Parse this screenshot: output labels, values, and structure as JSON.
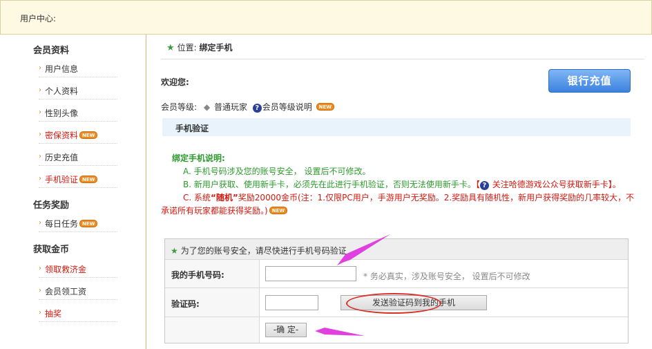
{
  "header": {
    "title": "用户中心:"
  },
  "sidebar": {
    "groups": [
      {
        "title": "会员资料",
        "items": [
          {
            "label": "用户信息",
            "color": "normal",
            "new": false
          },
          {
            "label": "个人资料",
            "color": "normal",
            "new": false
          },
          {
            "label": "性别头像",
            "color": "normal",
            "new": false
          },
          {
            "label": "密保资料",
            "color": "red",
            "new": true
          },
          {
            "label": "历史充值",
            "color": "normal",
            "new": false
          },
          {
            "label": "手机验证",
            "color": "red",
            "new": true
          }
        ]
      },
      {
        "title": "任务奖励",
        "items": [
          {
            "label": "每日任务",
            "color": "normal",
            "new": true
          }
        ]
      },
      {
        "title": "获取金币",
        "items": [
          {
            "label": "领取救济金",
            "color": "red",
            "new": false
          },
          {
            "label": "会员领工资",
            "color": "normal",
            "new": false
          },
          {
            "label": "抽奖",
            "color": "red",
            "new": false
          }
        ]
      }
    ],
    "new_badge": "NEW"
  },
  "main": {
    "position_prefix": "位置:",
    "position_value": "绑定手机",
    "welcome": "欢迎您:",
    "level_label": "会员等级:",
    "level_value": "普通玩家",
    "level_help": "会员等级说明",
    "bank_button": "银行充值",
    "section_title": "手机验证",
    "notes": {
      "title": "绑定手机说明:",
      "a": "A. 手机号码涉及您的账号安全， 设置后不可修改。",
      "b_green": "B. 新用户获取、使用新手卡，必须先在此进行手机验证，否则无法使用新手卡。",
      "b_bracket_open": "【",
      "b_red": "关注哈德游戏公众号获取新手卡",
      "b_bracket_close": "】。",
      "c_prefix": "C. 系统",
      "c_random": "“随机”",
      "c_rest": "奖励20000金币(注：1.仅限PC用户，手游用户无奖励。2.奖励具有随机性，新用户获得奖励的几率较大，不承诺所有玩家都能获得奖励。)"
    },
    "form": {
      "header": "为了您的账号安全，请尽快进行手机号码验证",
      "phone_label": "我的手机号码:",
      "phone_value": "",
      "phone_hint": "* 务必真实，涉及账号安全， 设置后不可修改",
      "code_label": "验证码:",
      "code_value": "",
      "send_button": "发送验证码到我的手机",
      "confirm_button": "-确 定-"
    }
  },
  "colors": {
    "accent_green": "#2c9a2c",
    "alert_red": "#d4180e",
    "annotation_magenta": "#e040e0",
    "annotation_circle": "#d9302a",
    "bank_button_blue": "#3d82de"
  }
}
